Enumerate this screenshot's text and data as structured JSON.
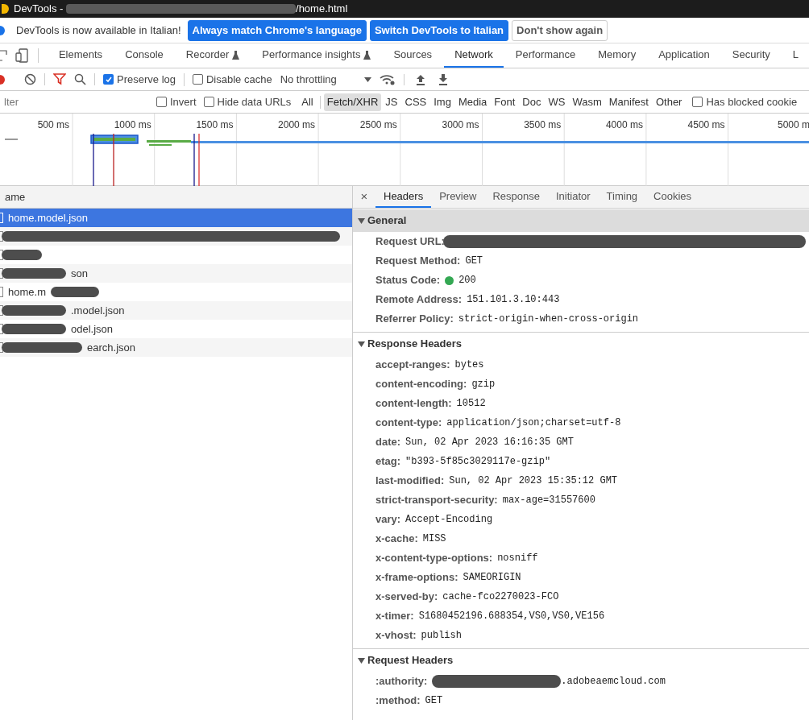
{
  "window": {
    "title_prefix": "DevTools - ",
    "title_suffix": "/home.html"
  },
  "infobar": {
    "message": "DevTools is now available in Italian!",
    "buttons": [
      {
        "label": "Always match Chrome's language",
        "kind": "primary"
      },
      {
        "label": "Switch DevTools to Italian",
        "kind": "primary"
      },
      {
        "label": "Don't show again",
        "kind": "secondary"
      }
    ]
  },
  "tabs": [
    {
      "label": "Elements",
      "selected": false
    },
    {
      "label": "Console",
      "selected": false
    },
    {
      "label": "Recorder",
      "selected": false,
      "experimental": true
    },
    {
      "label": "Performance insights",
      "selected": false,
      "experimental": true
    },
    {
      "label": "Sources",
      "selected": false
    },
    {
      "label": "Network",
      "selected": true
    },
    {
      "label": "Performance",
      "selected": false
    },
    {
      "label": "Memory",
      "selected": false
    },
    {
      "label": "Application",
      "selected": false
    },
    {
      "label": "Security",
      "selected": false
    },
    {
      "label": "L",
      "selected": false
    }
  ],
  "toolbar": {
    "preserve_log": {
      "label": "Preserve log",
      "checked": true
    },
    "disable_cache": {
      "label": "Disable cache",
      "checked": false
    },
    "throttling": "No throttling"
  },
  "filter": {
    "placeholder": "lter",
    "invert": {
      "label": "Invert",
      "checked": false
    },
    "hide_data_urls": {
      "label": "Hide data URLs",
      "checked": false
    },
    "types": [
      {
        "label": "All",
        "selected": false
      },
      {
        "label": "Fetch/XHR",
        "selected": true
      },
      {
        "label": "JS",
        "selected": false
      },
      {
        "label": "CSS",
        "selected": false
      },
      {
        "label": "Img",
        "selected": false
      },
      {
        "label": "Media",
        "selected": false
      },
      {
        "label": "Font",
        "selected": false
      },
      {
        "label": "Doc",
        "selected": false
      },
      {
        "label": "WS",
        "selected": false
      },
      {
        "label": "Wasm",
        "selected": false
      },
      {
        "label": "Manifest",
        "selected": false
      },
      {
        "label": "Other",
        "selected": false
      }
    ],
    "blocked_cookies": {
      "label": "Has blocked cookie",
      "checked": false
    }
  },
  "timeline": {
    "ticks": [
      "500 ms",
      "1000 ms",
      "1500 ms",
      "2000 ms",
      "2500 ms",
      "3000 ms",
      "3500 ms",
      "4000 ms",
      "4500 ms",
      "5000 m"
    ]
  },
  "requests": {
    "column": "ame",
    "rows": [
      {
        "name": "home.model.json",
        "selected": true,
        "kind": "plain"
      },
      {
        "selected": false,
        "kind": "redacted"
      },
      {
        "selected": false,
        "kind": "redacted_short"
      },
      {
        "name": "son",
        "selected": false,
        "kind": "redacted_before"
      },
      {
        "name": "home.m",
        "selected": false,
        "kind": "redacted_after"
      },
      {
        "name": ".model.json",
        "selected": false,
        "kind": "redacted_before"
      },
      {
        "name": "odel.json",
        "selected": false,
        "kind": "redacted_before"
      },
      {
        "name": "earch.json",
        "selected": false,
        "kind": "redacted_before"
      }
    ]
  },
  "detail_close": "×",
  "detail_tabs": [
    {
      "label": "Headers",
      "selected": true
    },
    {
      "label": "Preview",
      "selected": false
    },
    {
      "label": "Response",
      "selected": false
    },
    {
      "label": "Initiator",
      "selected": false
    },
    {
      "label": "Timing",
      "selected": false
    },
    {
      "label": "Cookies",
      "selected": false
    }
  ],
  "sections": [
    {
      "title": "General",
      "expanded": true,
      "focused": true,
      "rows": [
        {
          "name": "Request URL:",
          "kind": "redacted"
        },
        {
          "name": "Request Method:",
          "value": "GET",
          "kind": "plain"
        },
        {
          "name": "Status Code:",
          "value": "200",
          "color": "#34a853",
          "kind": "plain"
        },
        {
          "name": "Remote Address:",
          "value": "151.101.3.10:443",
          "kind": "plain"
        },
        {
          "name": "Referrer Policy:",
          "value": "strict-origin-when-cross-origin",
          "kind": "plain"
        }
      ]
    },
    {
      "title": "Response Headers",
      "expanded": true,
      "focused": false,
      "rows": [
        {
          "name": "accept-ranges:",
          "value": "bytes",
          "kind": "plain"
        },
        {
          "name": "content-encoding:",
          "value": "gzip",
          "kind": "plain"
        },
        {
          "name": "content-length:",
          "value": "10512",
          "kind": "plain"
        },
        {
          "name": "content-type:",
          "value": "application/json;charset=utf-8",
          "kind": "plain"
        },
        {
          "name": "date:",
          "value": "Sun, 02 Apr 2023 16:16:35 GMT",
          "kind": "plain"
        },
        {
          "name": "etag:",
          "value": "\"b393-5f85c3029117e-gzip\"",
          "kind": "plain"
        },
        {
          "name": "last-modified:",
          "value": "Sun, 02 Apr 2023 15:35:12 GMT",
          "kind": "plain"
        },
        {
          "name": "strict-transport-security:",
          "value": "max-age=31557600",
          "kind": "plain"
        },
        {
          "name": "vary:",
          "value": "Accept-Encoding",
          "kind": "plain"
        },
        {
          "name": "x-cache:",
          "value": "MISS",
          "kind": "plain"
        },
        {
          "name": "x-content-type-options:",
          "value": "nosniff",
          "kind": "plain"
        },
        {
          "name": "x-frame-options:",
          "value": "SAMEORIGIN",
          "kind": "plain"
        },
        {
          "name": "x-served-by:",
          "value": "cache-fco2270023-FCO",
          "kind": "plain"
        },
        {
          "name": "x-timer:",
          "value": "S1680452196.688354,VS0,VS0,VE156",
          "kind": "plain"
        },
        {
          "name": "x-vhost:",
          "value": "publish",
          "kind": "plain"
        }
      ]
    },
    {
      "title": "Request Headers",
      "expanded": true,
      "focused": false,
      "rows": [
        {
          "name": ":authority:",
          "value": ".adobeaemcloud.com",
          "kind": "redacted_before"
        },
        {
          "name": ":method:",
          "value": "GET",
          "kind": "plain"
        }
      ]
    }
  ]
}
